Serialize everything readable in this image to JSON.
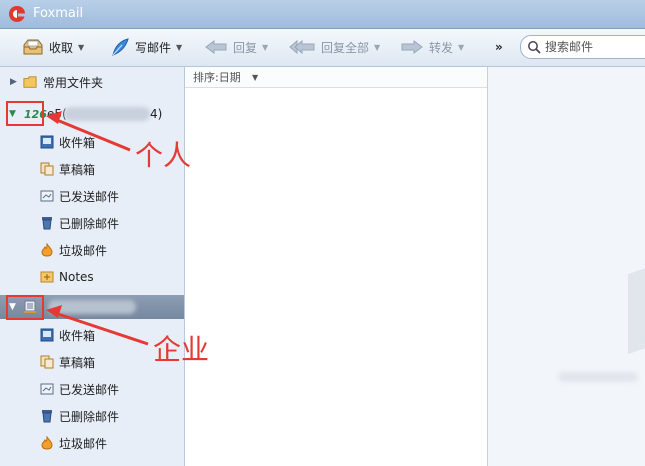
{
  "window": {
    "title": "Foxmail"
  },
  "toolbar": {
    "receive": "收取",
    "compose": "写邮件",
    "reply": "回复",
    "reply_all": "回复全部",
    "forward": "转发",
    "more": "»"
  },
  "search": {
    "placeholder": "搜索邮件"
  },
  "sort": {
    "label": "排序:日期"
  },
  "folders": {
    "common": "常用文件夹",
    "personal": {
      "badge": "126",
      "account_visible_fragment_left": "e5(",
      "account_visible_fragment_right": "4)",
      "items": [
        "收件箱",
        "草稿箱",
        "已发送邮件",
        "已删除邮件",
        "垃圾邮件",
        "Notes"
      ]
    },
    "enterprise": {
      "items": [
        "收件箱",
        "草稿箱",
        "已发送邮件",
        "已删除邮件",
        "垃圾邮件"
      ]
    }
  },
  "annotations": {
    "personal": "个人",
    "enterprise": "企业"
  },
  "colors": {
    "annotation_red": "#e53935",
    "selected_row": "#7c8ea5",
    "title_bar": "#a9c3e0"
  }
}
